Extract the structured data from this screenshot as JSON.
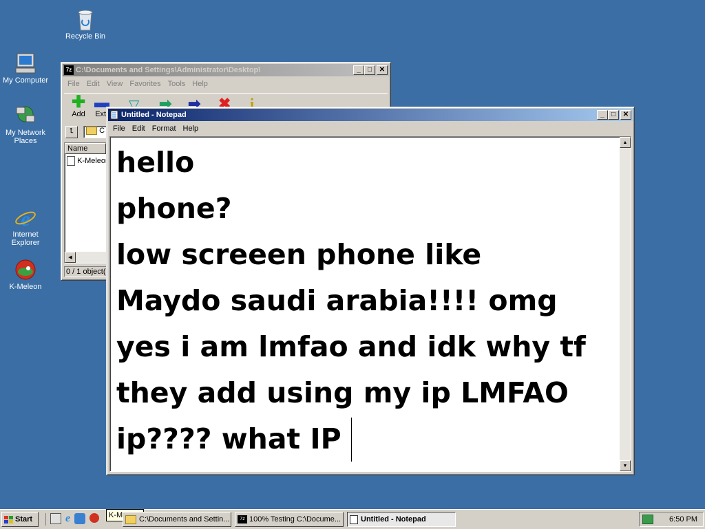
{
  "desktop": {
    "icons": [
      {
        "label": "Recycle Bin",
        "icon": "recycle-bin-icon"
      },
      {
        "label": "My Computer",
        "icon": "my-computer-icon"
      },
      {
        "label": "My Network Places",
        "icon": "network-places-icon"
      },
      {
        "label": "Internet Explorer",
        "icon": "internet-explorer-icon"
      },
      {
        "label": "K-Meleon",
        "icon": "k-meleon-icon"
      }
    ]
  },
  "explorer": {
    "title": "C:\\Documents and Settings\\Administrator\\Desktop\\",
    "menu": [
      "File",
      "Edit",
      "View",
      "Favorites",
      "Tools",
      "Help"
    ],
    "toolbar": {
      "add_label": "Add",
      "extract_label": "Extr"
    },
    "address_partial": "C",
    "column_name": "Name",
    "file_item": "K-Meleon",
    "status": "0 / 1 object(s"
  },
  "notepad": {
    "title": "Untitled - Notepad",
    "menu": [
      "File",
      "Edit",
      "Format",
      "Help"
    ],
    "lines": [
      "hello",
      "phone?",
      "low screeen phone like",
      "Maydo saudi arabia!!!! omg",
      "yes i am lmfao and idk why tf",
      "they add using my ip LMFAO",
      "ip???? what IP "
    ]
  },
  "taskbar": {
    "start_label": "Start",
    "tooltip": "K-Meleon",
    "buttons": [
      "C:\\Documents and Settin...",
      "100% Testing C:\\Docume...",
      "Untitled - Notepad"
    ],
    "clock": "6:50 PM"
  },
  "colors": {
    "desktop": "#3a6ea5",
    "active_title": "#0a246a",
    "inactive_title": "#808080",
    "chrome": "#d4d0c8"
  }
}
